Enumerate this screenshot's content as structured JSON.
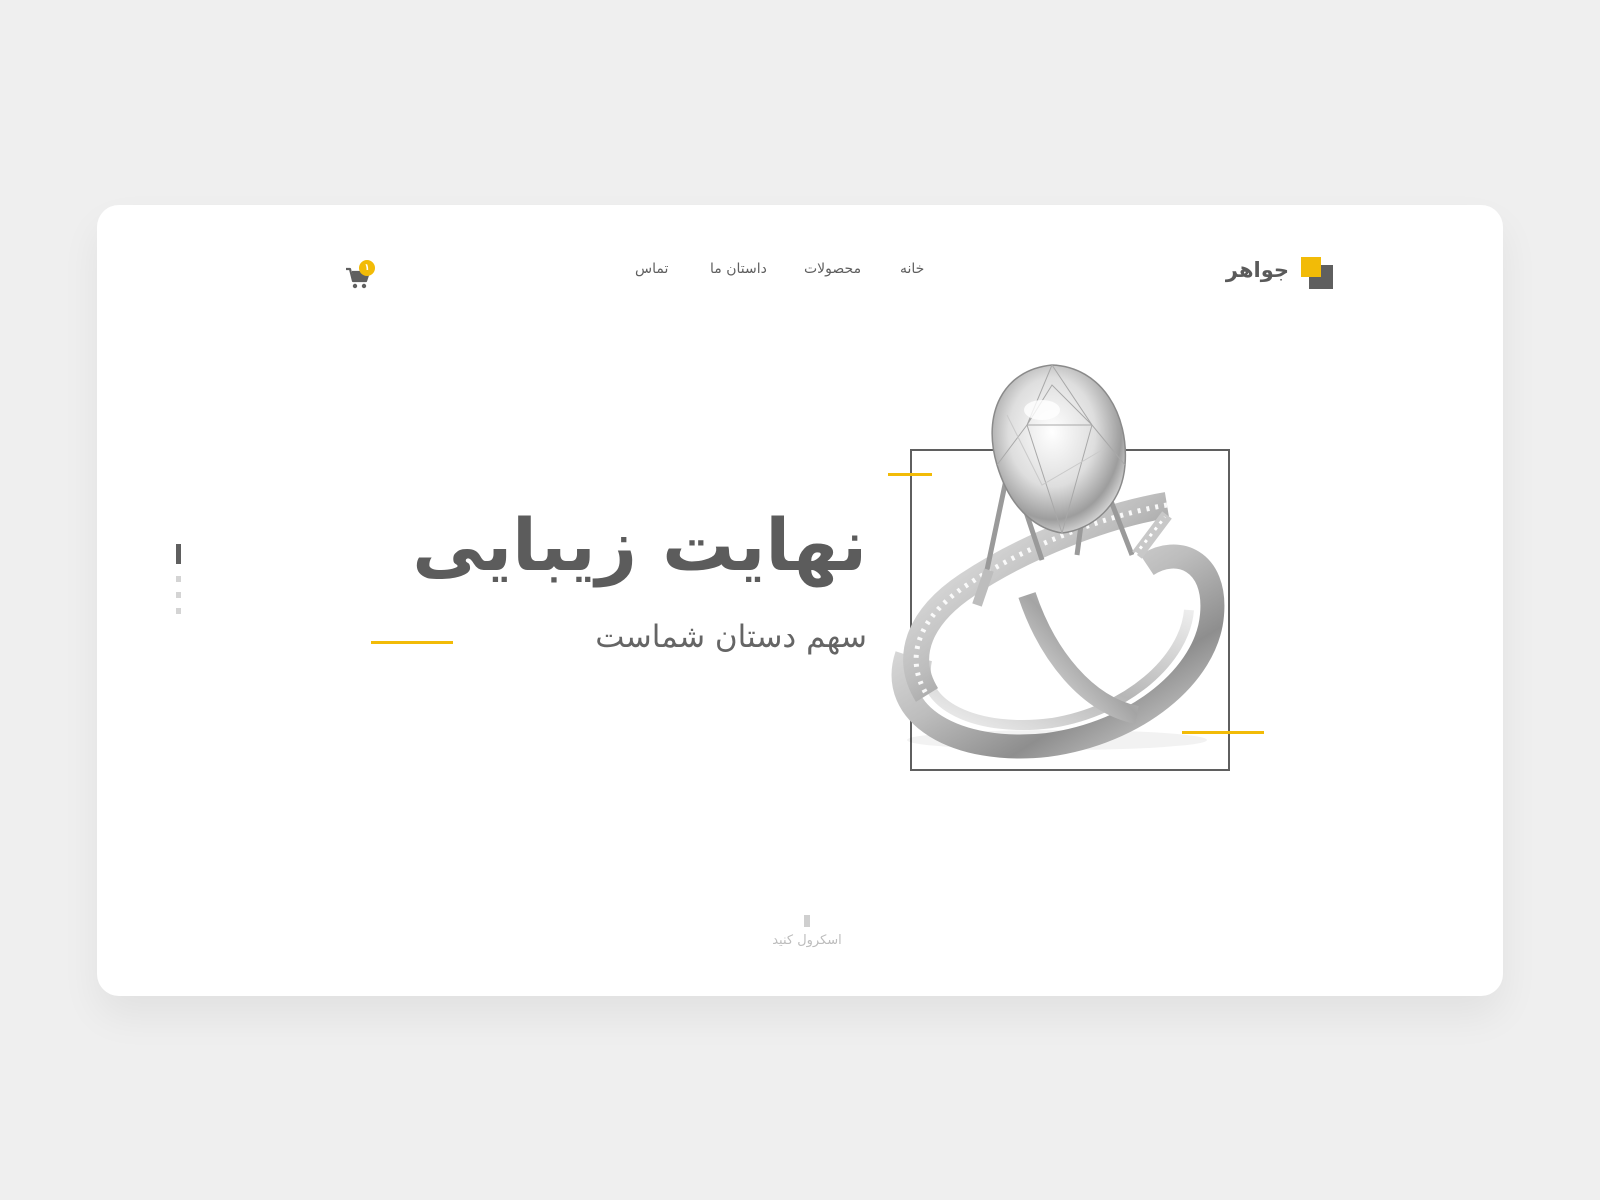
{
  "brand": {
    "name": "جواهر",
    "colors": {
      "accent": "#f2bb07",
      "dark": "#5f5f5f",
      "background": "#efefef",
      "card": "#ffffff"
    }
  },
  "nav": {
    "items": [
      {
        "label": "خانه"
      },
      {
        "label": "محصولات"
      },
      {
        "label": "داستان ما"
      },
      {
        "label": "تماس"
      }
    ]
  },
  "cart": {
    "icon": "shopping-cart-icon",
    "count": "۱"
  },
  "hero": {
    "title": "نهایت زیبایی",
    "subtitle": "سهم دستان شماست",
    "image": "diamond-ring-image",
    "slide_indicator": {
      "total": 4,
      "active": 1
    }
  },
  "scroll": {
    "label": "اسکرول کنید"
  }
}
